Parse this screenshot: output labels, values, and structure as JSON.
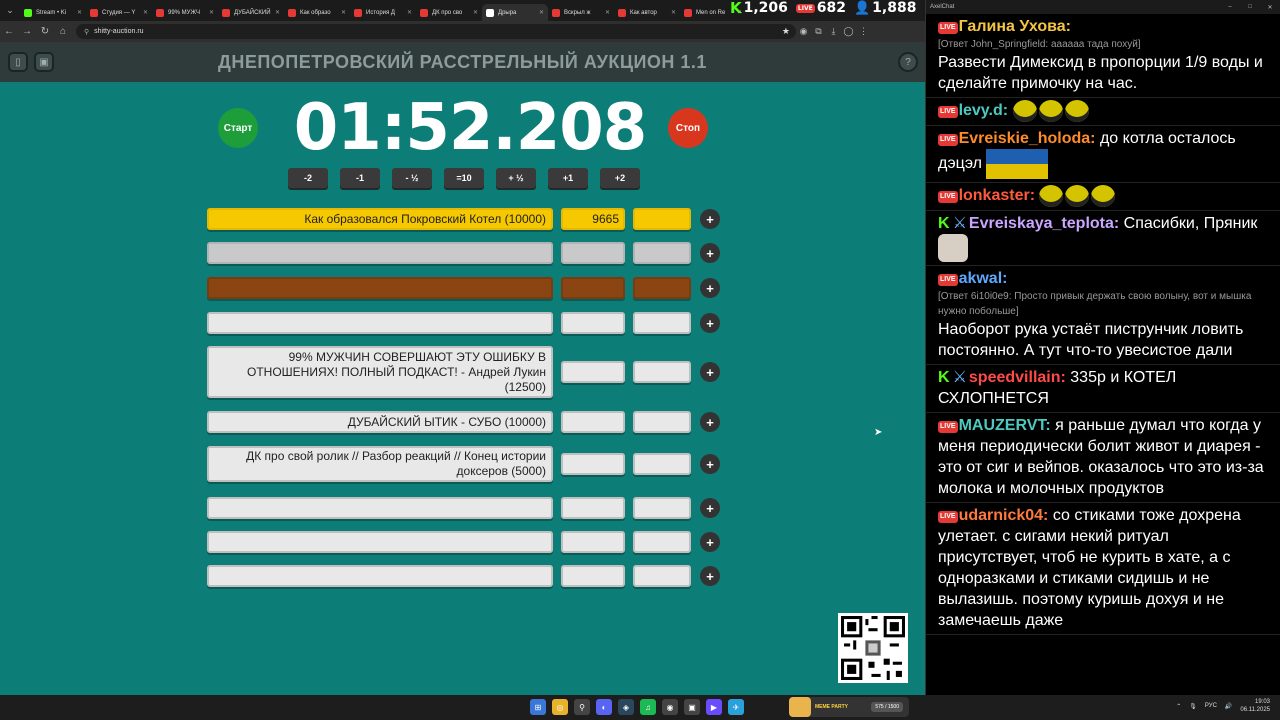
{
  "browser": {
    "tabs": [
      {
        "label": "Stream • Ki",
        "color": "#53fc18"
      },
      {
        "label": "Студия — Y",
        "color": "#e53935"
      },
      {
        "label": "99% МУЖЧ",
        "color": "#e53935"
      },
      {
        "label": "ДУБАЙСКИЙ",
        "color": "#e53935"
      },
      {
        "label": "Как образо",
        "color": "#e53935"
      },
      {
        "label": "История Д",
        "color": "#e53935"
      },
      {
        "label": "ДК про сво",
        "color": "#e53935"
      },
      {
        "label": "Дрыра",
        "color": "#ffffff",
        "active": true
      },
      {
        "label": "Вскрыл ж",
        "color": "#e53935"
      },
      {
        "label": "Как автор",
        "color": "#e53935"
      },
      {
        "label": "Men on Re",
        "color": "#e53935"
      }
    ],
    "url": "shitty-auction.ru",
    "stats": {
      "kick": "1,206",
      "live": "682",
      "viewers": "1,888"
    }
  },
  "page": {
    "title": "ДНЕПОПЕТРОВСКИЙ РАССТРЕЛЬНЫЙ АУКЦИОН 1.1",
    "start_label": "Старт",
    "stop_label": "Стоп",
    "timer": "01:52.208",
    "adjust_buttons": [
      "-2",
      "-1",
      "- ½",
      "=10",
      "+ ½",
      "+1",
      "+2"
    ],
    "plus_label": "+",
    "lots": [
      {
        "name": "Как образовался Покровский Котел (10000)",
        "sum": "9665"
      },
      {
        "name": "",
        "sum": ""
      },
      {
        "name": "",
        "sum": ""
      },
      {
        "name": "",
        "sum": ""
      },
      {
        "name": "99% МУЖЧИН СОВЕРШАЮТ ЭТУ ОШИБКУ В ОТНОШЕНИЯХ! ПОЛНЫЙ ПОДКАСТ! - Андрей Лукин (12500)",
        "sum": ""
      },
      {
        "name": "ДУБАЙСКИЙ ЫТИК - СУБО (10000)",
        "sum": ""
      },
      {
        "name": "ДК про свой ролик // Разбор реакций // Конец истории доксеров (5000)",
        "sum": ""
      },
      {
        "name": "",
        "sum": ""
      },
      {
        "name": "",
        "sum": ""
      },
      {
        "name": "",
        "sum": ""
      }
    ]
  },
  "chat": {
    "title": "AxelChat",
    "messages": [
      {
        "platform": "live",
        "name": "Галина Ухова:",
        "color": "#f4c542",
        "reply": "[Ответ John_Springfield: аааааа тада похуй]",
        "text": "Развести Димексид в пропорции 1/9 воды и сделайте примочку на час."
      },
      {
        "platform": "live",
        "name": "levy.d:",
        "color": "#4cc9c0",
        "text": "",
        "emotes": 3
      },
      {
        "platform": "live",
        "name": "Evreiskie_holoda:",
        "color": "#ff8c2a",
        "text": "до котла осталось дэцэл",
        "flags": true
      },
      {
        "platform": "live",
        "name": "lonkaster:",
        "color": "#ff5a3c",
        "text": "",
        "emotes": 3
      },
      {
        "platform": "kick",
        "name": "Evreiskaya_teplota:",
        "color": "#c9a6ff",
        "text": "Спасибки, Пряник"
      },
      {
        "platform": "live",
        "name": "akwal:",
        "color": "#5ea8ff",
        "reply": "[Ответ 6i10i0e9: Просто привык держать свою волыну, вот и мышка нужно побольше]",
        "text": "Наоборот рука устаёт пиструнчик ловить постоянно. А тут что-то увесистое дали"
      },
      {
        "platform": "kick",
        "name": "speedvillain:",
        "color": "#ff4a4a",
        "text": "335р и КОТЕЛ СХЛОПНЕТСЯ"
      },
      {
        "platform": "live",
        "name": "MAUZERVT:",
        "color": "#4cc9c0",
        "text": "я раньше думал что когда у меня периодически болит живот и диарея - это от сиг и вейпов. оказалось что это из-за молока и молочных продуктов"
      },
      {
        "platform": "live",
        "name": "udarnick04:",
        "color": "#ff7a3c",
        "text": "со стиками тоже дохрена улетает. с сигами некий ритуал присутствует, чтоб не курить в хате, а с одноразками и стиками сидишь и не вылазишь. поэтому куришь дохуя и не замечаешь даже"
      }
    ]
  },
  "taskbar": {
    "meme_label": "MEME PARTY",
    "meme_progress": "575 / 1500",
    "lang": "РУС",
    "time": "19:03",
    "date": "06.11.2025"
  }
}
